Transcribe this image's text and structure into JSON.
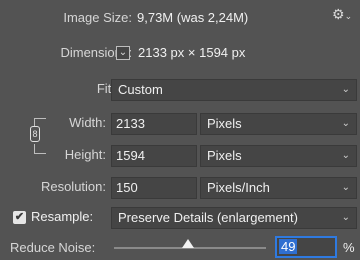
{
  "image_size": {
    "label": "Image Size:",
    "value": "9,73M (was 2,24M)"
  },
  "settings_icon": {
    "name": "gear-icon",
    "glyph": "⚙",
    "menu_glyph": "⌄"
  },
  "dimensions": {
    "label": "Dimensions:",
    "width_value": "2133 px",
    "times": "×",
    "height_value": "1594 px",
    "chevron_glyph": "⌄"
  },
  "fit_to": {
    "label": "Fit To:",
    "value": "Custom"
  },
  "width": {
    "label": "Width:",
    "value": "2133",
    "unit": "Pixels"
  },
  "height": {
    "label": "Height:",
    "value": "1594",
    "unit": "Pixels"
  },
  "constrain_icon": {
    "name": "link-icon",
    "glyph": "8"
  },
  "resolution": {
    "label": "Resolution:",
    "value": "150",
    "unit": "Pixels/Inch"
  },
  "resample": {
    "label": "Resample:",
    "checked": true,
    "check_glyph": "✔",
    "method": "Preserve Details (enlargement)"
  },
  "reduce_noise": {
    "label": "Reduce Noise:",
    "value": "49",
    "percent_sign": "%",
    "slider_fraction": 0.49
  },
  "dropdown_chevron": "⌄",
  "colors": {
    "background": "#535353",
    "field_background": "#454545",
    "focus_accent": "#2f7ae0"
  }
}
